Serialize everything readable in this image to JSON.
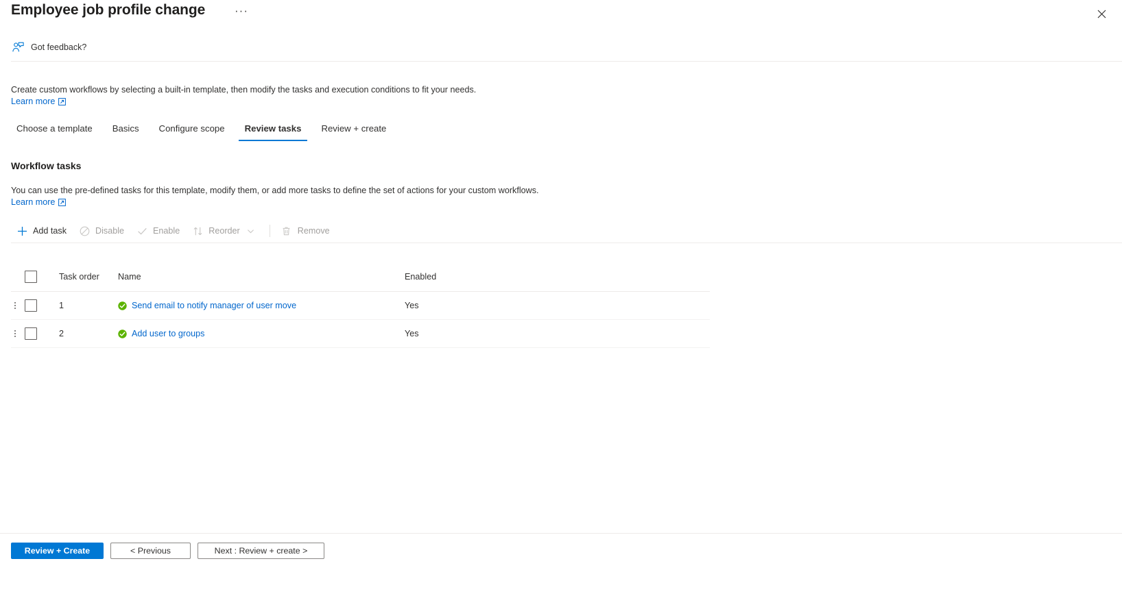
{
  "titlebar": {
    "title": "Employee job profile change",
    "more_label": "···",
    "close_icon": "close-icon"
  },
  "feedback": {
    "label": "Got feedback?",
    "icon": "feedback-person-icon"
  },
  "intro": {
    "text": "Create custom workflows by selecting a built-in template, then modify the tasks and execution conditions to fit your needs.",
    "learn_more": "Learn more"
  },
  "tabs": [
    {
      "label": "Choose a template",
      "active": false
    },
    {
      "label": "Basics",
      "active": false
    },
    {
      "label": "Configure scope",
      "active": false
    },
    {
      "label": "Review tasks",
      "active": true
    },
    {
      "label": "Review + create",
      "active": false
    }
  ],
  "section": {
    "title": "Workflow tasks",
    "description": "You can use the pre-defined tasks for this template, modify them, or add more tasks to define the set of actions for your custom workflows.",
    "learn_more": "Learn more"
  },
  "commandbar": {
    "add_task": "Add task",
    "disable": "Disable",
    "enable": "Enable",
    "reorder": "Reorder",
    "remove": "Remove"
  },
  "table": {
    "columns": {
      "task_order": "Task order",
      "name": "Name",
      "enabled": "Enabled"
    },
    "rows": [
      {
        "order": "1",
        "name": "Send email to notify manager of user move",
        "enabled": "Yes",
        "status": "enabled-check"
      },
      {
        "order": "2",
        "name": "Add user to groups",
        "enabled": "Yes",
        "status": "enabled-check"
      }
    ]
  },
  "footer": {
    "review_create": "Review + Create",
    "previous": "< Previous",
    "next": "Next : Review + create >"
  },
  "colors": {
    "accent": "#0078d4",
    "link": "#0066cc",
    "status_green": "#5cb300",
    "disabled_text": "#a19f9d"
  }
}
